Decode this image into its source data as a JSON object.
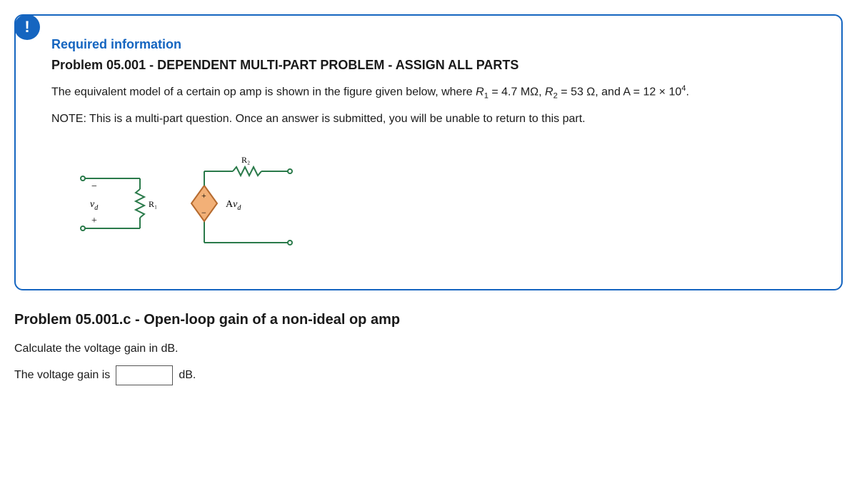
{
  "info": {
    "badge": "!",
    "required_label": "Required information",
    "problem_heading": "Problem 05.001 - DEPENDENT MULTI-PART PROBLEM - ASSIGN ALL PARTS",
    "description_pre": "The equivalent model of a certain op amp is shown in the figure given below, where ",
    "R1_label": "R",
    "R1_sub": "1",
    "R1_val": " = 4.7 MΩ, ",
    "R2_label": "R",
    "R2_sub": "2",
    "R2_val": " = 53 Ω, and A = 12 × 10",
    "exponent": "4",
    "period": ".",
    "note": "NOTE: This is a multi-part question. Once an answer is submitted, you will be unable to return to this part."
  },
  "circuit": {
    "vd": "v",
    "vd_sub": "d",
    "R1": "R₁",
    "R2": "R₂",
    "Avd_A": "A",
    "Avd_v": "v",
    "Avd_d": "d",
    "minus": "−",
    "plus": "+"
  },
  "subproblem": {
    "heading": "Problem 05.001.c - Open-loop gain of a non-ideal op amp",
    "prompt": "Calculate the voltage gain in dB.",
    "answer_prefix": "The voltage gain is",
    "answer_unit": "dB.",
    "input_value": ""
  }
}
